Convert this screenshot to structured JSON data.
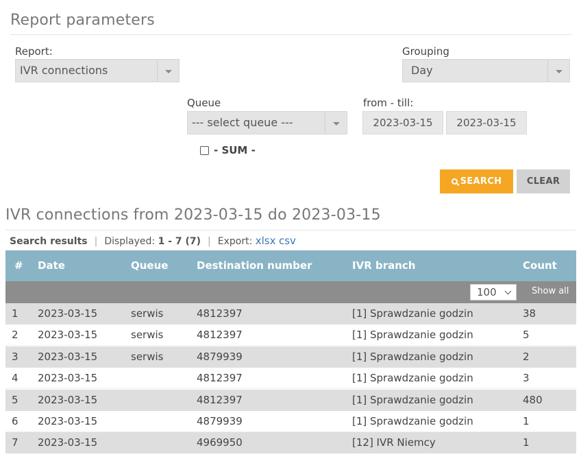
{
  "form": {
    "title": "Report parameters",
    "report_label": "Report:",
    "report_value": "IVR connections",
    "grouping_label": "Grouping",
    "grouping_value": "Day",
    "queue_label": "Queue",
    "queue_value": "--- select queue ---",
    "range_label": "from - till:",
    "date_from": "2023-03-15",
    "date_till": "2023-03-15",
    "sum_label": "- SUM -",
    "sum_checked": false,
    "search_label": "SEARCH",
    "clear_label": "CLEAR"
  },
  "results": {
    "title": "IVR connections from 2023-03-15 do 2023-03-15",
    "search_results_label": "Search results",
    "displayed_label": "Displayed:",
    "displayed_value": "1 - 7 (7)",
    "export_label": "Export:",
    "export_xlsx": "xlsx",
    "export_csv": "csv",
    "columns": [
      "#",
      "Date",
      "Queue",
      "Destination number",
      "IVR branch",
      "Count"
    ],
    "page_size": "100",
    "show_all_label": "Show all",
    "rows": [
      {
        "n": "1",
        "date": "2023-03-15",
        "queue": "serwis",
        "dest": "4812397",
        "branch": "[1] Sprawdzanie godzin",
        "count": "38"
      },
      {
        "n": "2",
        "date": "2023-03-15",
        "queue": "serwis",
        "dest": "4812397",
        "branch": "[1] Sprawdzanie godzin",
        "count": "5"
      },
      {
        "n": "3",
        "date": "2023-03-15",
        "queue": "serwis",
        "dest": "4879939",
        "branch": "[1] Sprawdzanie godzin",
        "count": "2"
      },
      {
        "n": "4",
        "date": "2023-03-15",
        "queue": "",
        "dest": "4812397",
        "branch": "[1] Sprawdzanie godzin",
        "count": "3"
      },
      {
        "n": "5",
        "date": "2023-03-15",
        "queue": "",
        "dest": "4812397",
        "branch": "[1] Sprawdzanie godzin",
        "count": "480"
      },
      {
        "n": "6",
        "date": "2023-03-15",
        "queue": "",
        "dest": "4879939",
        "branch": "[1] Sprawdzanie godzin",
        "count": "1"
      },
      {
        "n": "7",
        "date": "2023-03-15",
        "queue": "",
        "dest": "4969950",
        "branch": "[12] IVR Niemcy",
        "count": "1"
      }
    ]
  },
  "colors": {
    "accent": "#f5a623",
    "table_header": "#89b4c5",
    "link": "#3a78b5"
  }
}
